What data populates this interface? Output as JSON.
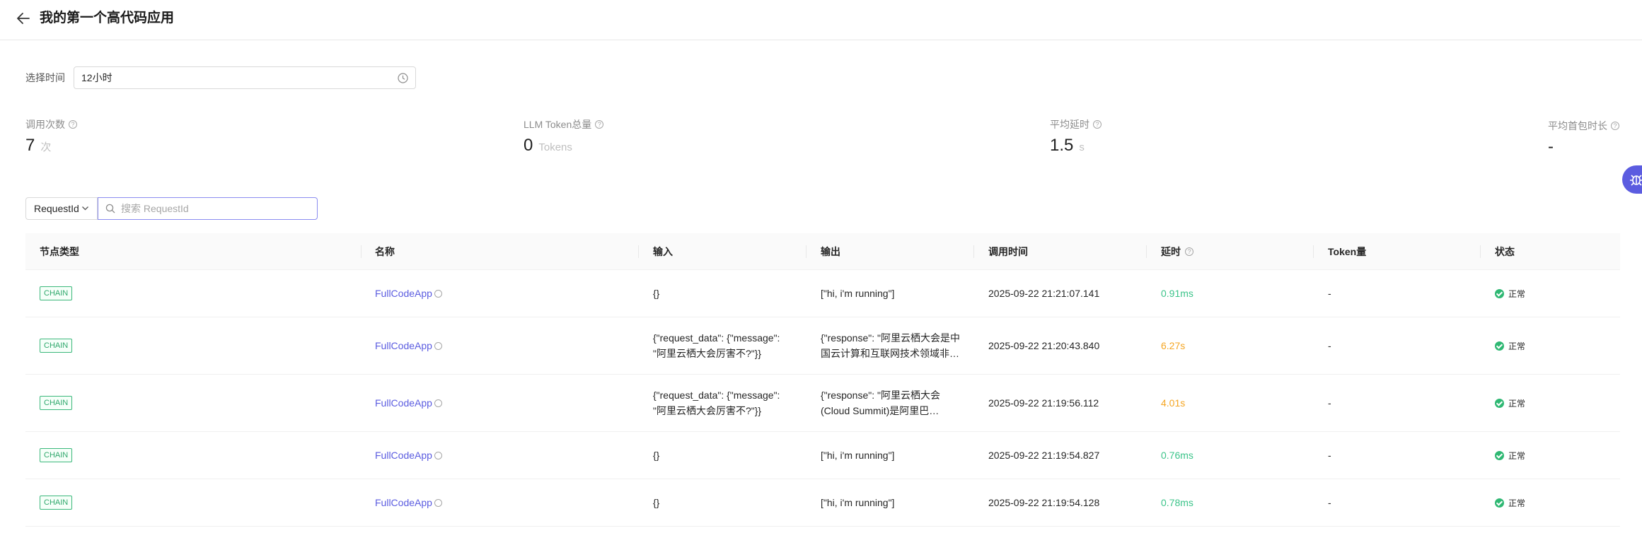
{
  "header": {
    "title": "我的第一个高代码应用"
  },
  "filter": {
    "label": "选择时间",
    "value": "12小时"
  },
  "stats": [
    {
      "label": "调用次数",
      "value": "7",
      "unit": "次"
    },
    {
      "label": "LLM Token总量",
      "value": "0",
      "unit": "Tokens"
    },
    {
      "label": "平均延时",
      "value": "1.5",
      "unit": "s"
    },
    {
      "label": "平均首包时长",
      "value": "-",
      "unit": ""
    }
  ],
  "search": {
    "type": "RequestId",
    "placeholder": "搜索 RequestId"
  },
  "columns": [
    "节点类型",
    "名称",
    "输入",
    "输出",
    "调用时间",
    "延时",
    "Token量",
    "状态"
  ],
  "rows": [
    {
      "type": "CHAIN",
      "name": "FullCodeApp",
      "input": "{}",
      "output": "[\"hi, i'm running\"]",
      "time": "2025-09-22 21:21:07.141",
      "latency": "0.91ms",
      "latency_level": "green",
      "tokens": "-",
      "status": "正常"
    },
    {
      "type": "CHAIN",
      "name": "FullCodeApp",
      "input": "{\"request_data\": {\"message\": \"阿里云栖大会厉害不?\"}}",
      "output": "{\"response\": \"阿里云栖大会是中国云计算和互联网技术领域非…",
      "time": "2025-09-22 21:20:43.840",
      "latency": "6.27s",
      "latency_level": "orange",
      "tokens": "-",
      "status": "正常"
    },
    {
      "type": "CHAIN",
      "name": "FullCodeApp",
      "input": "{\"request_data\": {\"message\": \"阿里云栖大会厉害不?\"}}",
      "output": "{\"response\": \"阿里云栖大会(Cloud Summit)是阿里巴…",
      "time": "2025-09-22 21:19:56.112",
      "latency": "4.01s",
      "latency_level": "orange",
      "tokens": "-",
      "status": "正常"
    },
    {
      "type": "CHAIN",
      "name": "FullCodeApp",
      "input": "{}",
      "output": "[\"hi, i'm running\"]",
      "time": "2025-09-22 21:19:54.827",
      "latency": "0.76ms",
      "latency_level": "green",
      "tokens": "-",
      "status": "正常"
    },
    {
      "type": "CHAIN",
      "name": "FullCodeApp",
      "input": "{}",
      "output": "[\"hi, i'm running\"]",
      "time": "2025-09-22 21:19:54.128",
      "latency": "0.78ms",
      "latency_level": "green",
      "tokens": "-",
      "status": "正常"
    }
  ],
  "colors": {
    "accent": "#5b5ce0",
    "success": "#2fb873",
    "warning": "#f5a623",
    "tag": "#3bb87b"
  }
}
